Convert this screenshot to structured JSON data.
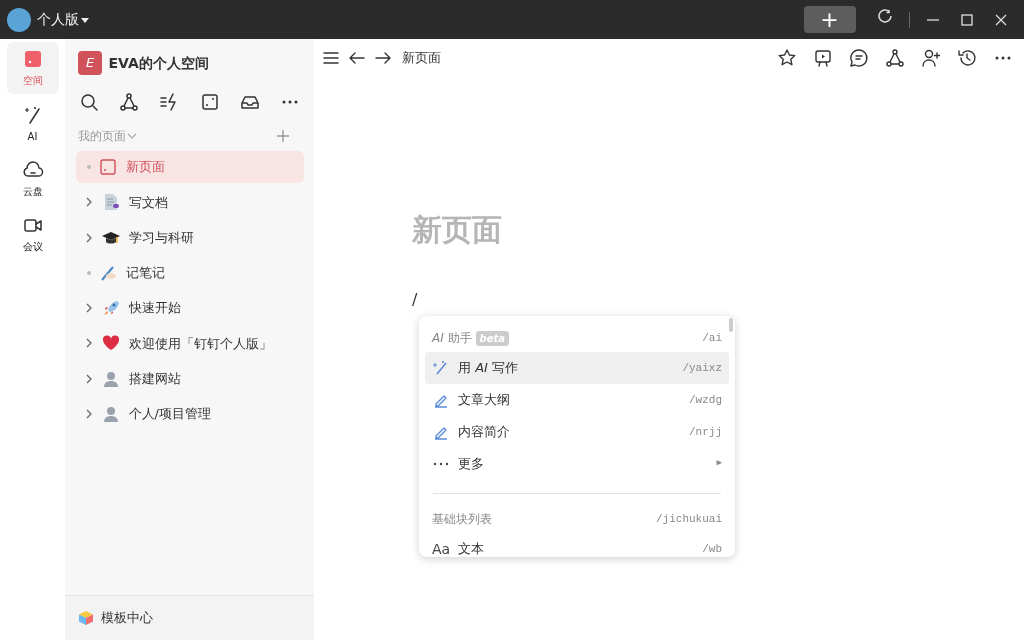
{
  "titlebar": {
    "title": "个人版",
    "new_button": "+"
  },
  "rail": [
    {
      "kind": "space",
      "label": "空间",
      "selected": true
    },
    {
      "kind": "ai",
      "label": "AI",
      "selected": false
    },
    {
      "kind": "cloud",
      "label": "云盘",
      "selected": false
    },
    {
      "kind": "meeting",
      "label": "会议",
      "selected": false
    }
  ],
  "workspace": {
    "initial": "E",
    "name": "EVA的个人空间"
  },
  "section": {
    "label": "我的页面"
  },
  "pages": [
    {
      "kind": "page",
      "label": "新页面",
      "selected": true,
      "collapsed": false
    },
    {
      "kind": "doc",
      "label": "写文档",
      "selected": false,
      "collapsed": true
    },
    {
      "kind": "cap",
      "label": "学习与科研",
      "selected": false,
      "collapsed": true
    },
    {
      "kind": "pen",
      "label": "记笔记",
      "selected": false,
      "collapsed": false
    },
    {
      "kind": "rocket",
      "label": "快速开始",
      "selected": false,
      "collapsed": true
    },
    {
      "kind": "heart",
      "label": "欢迎使用「钉钉个人版」",
      "selected": false,
      "collapsed": true
    },
    {
      "kind": "person",
      "label": "搭建网站",
      "selected": false,
      "collapsed": true
    },
    {
      "kind": "person",
      "label": "个人/项目管理",
      "selected": false,
      "collapsed": true
    }
  ],
  "template_center": "模板中心",
  "breadcrumb": "新页面",
  "document": {
    "title": "新页面",
    "typed": "/"
  },
  "slash_menu": {
    "groups": [
      {
        "heading": "*AI* 助手",
        "badge": "beta",
        "shortcut": "/ai",
        "items": [
          {
            "kind": "wand",
            "label": "用 *AI* 写作",
            "shortcut": "/yaixz",
            "selected": true
          },
          {
            "kind": "pencil",
            "label": "文章大纲",
            "shortcut": "/wzdg",
            "selected": false
          },
          {
            "kind": "pencil",
            "label": "内容简介",
            "shortcut": "/nrjj",
            "selected": false
          },
          {
            "kind": "more",
            "label": "更多",
            "shortcut": "▶",
            "selected": false
          }
        ]
      },
      {
        "heading": "基础块列表",
        "shortcut": "/jichukuai",
        "items": [
          {
            "kind": "text",
            "icon_text": "Aa",
            "label": "文本",
            "shortcut": "/wb",
            "selected": false
          }
        ]
      }
    ]
  }
}
